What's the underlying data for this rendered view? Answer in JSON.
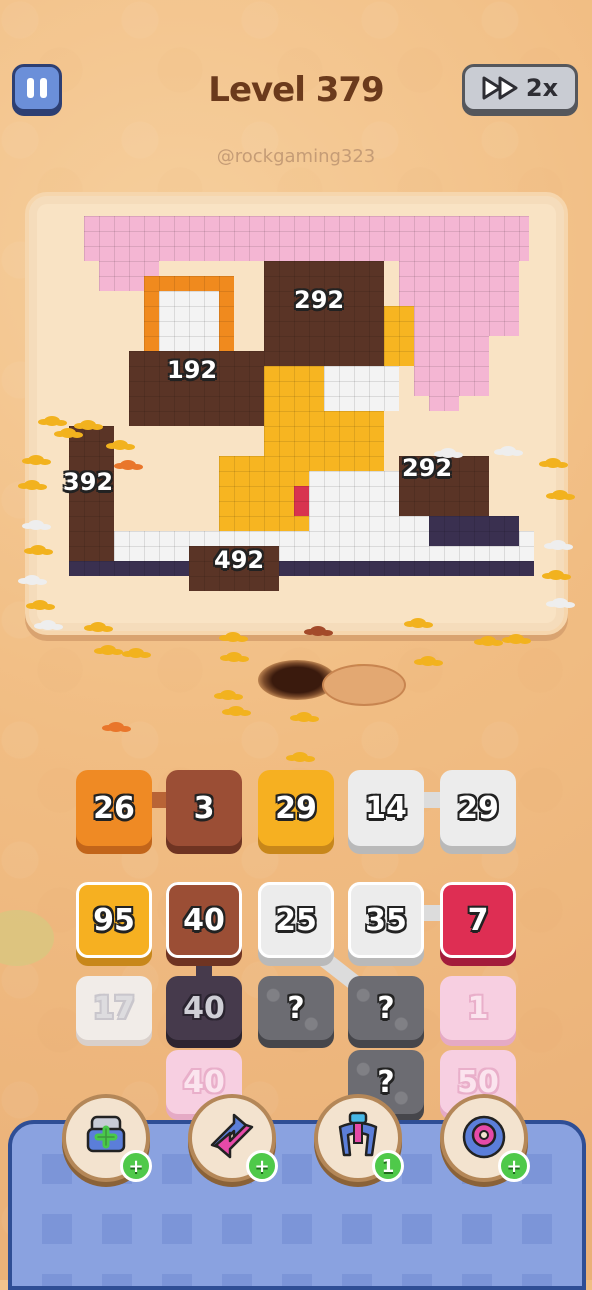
{
  "header": {
    "level_label": "Level 379",
    "speed_label": "2x",
    "watermark": "@rockgaming323"
  },
  "board": {
    "counts": {
      "choc_top": "292",
      "choc_left_top": "192",
      "choc_left": "392",
      "choc_right": "292",
      "choc_bottom": "492"
    }
  },
  "tiles": {
    "row1": [
      "26",
      "3",
      "29",
      "14",
      "29"
    ],
    "row2": [
      "95",
      "40",
      "25",
      "35",
      "7"
    ],
    "row3": [
      "17",
      "40",
      "?",
      "?",
      "1"
    ],
    "row4": [
      "40",
      "?",
      "50"
    ]
  },
  "boosters": {
    "add_tile_badge": "+",
    "swap_badge": "+",
    "magnet_badge": "1",
    "donut_badge": "+"
  },
  "colors": {
    "orange": "#ef8a24",
    "brown": "#9b4e35",
    "yellow": "#f6b021",
    "white": "#ececec",
    "red": "#de2e53",
    "tray_blue": "#7c95d8"
  }
}
